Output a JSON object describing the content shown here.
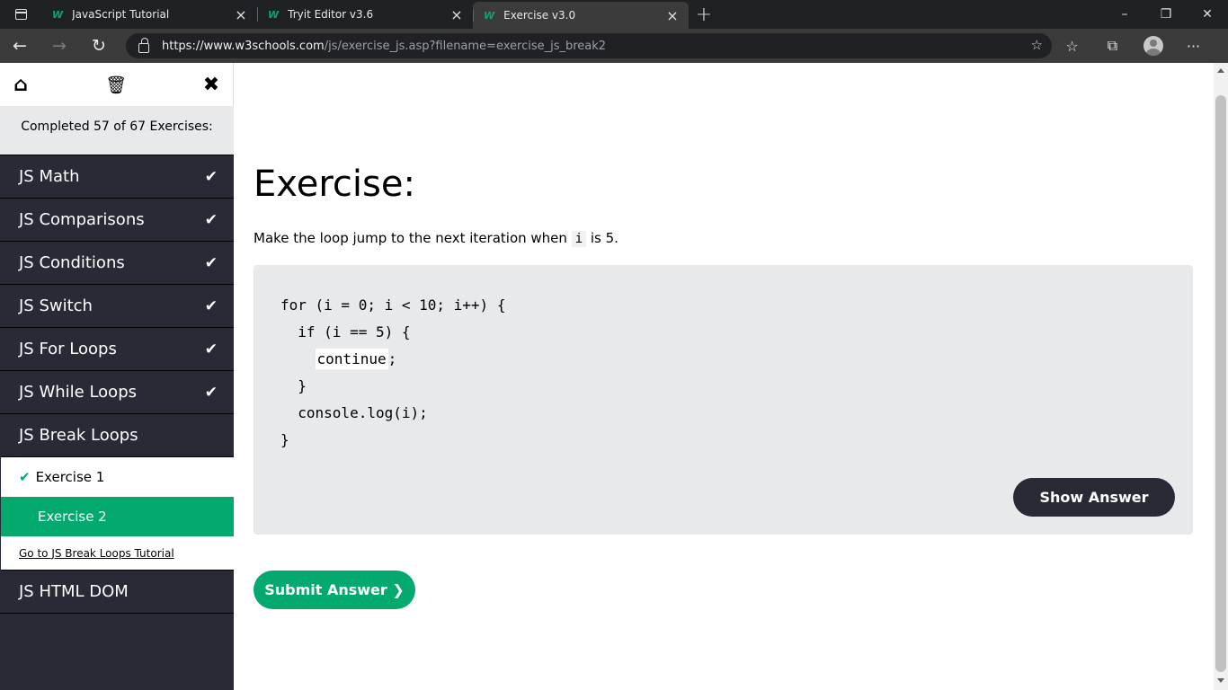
{
  "browser": {
    "tabs": [
      {
        "title": "JavaScript Tutorial",
        "favicon": "w3schools-logo"
      },
      {
        "title": "Tryit Editor v3.6",
        "favicon": "w3schools-logo"
      },
      {
        "title": "Exercise v3.0",
        "favicon": "w3schools-logo",
        "active": true
      }
    ],
    "favicon_text": "W",
    "tab_close": "×",
    "new_tab": "+",
    "url_host": "https://www.w3schools.com",
    "url_path": "/js/exercise_js.asp?filename=exercise_js_break2",
    "win_minimize": "–",
    "win_restore": "❐",
    "win_close": "✕",
    "nav_back": "←",
    "nav_forward": "→",
    "nav_reload": "↻",
    "fav_add": "☆",
    "favorites": "☆",
    "collections": "⧉",
    "more": "···"
  },
  "sidebar": {
    "home_icon": "⌂",
    "trash_icon": "🗑",
    "close_icon": "✖",
    "progress_text": "Completed 57 of 67 Exercises:",
    "check": "✔",
    "items": [
      {
        "label": "JS Math",
        "done": true
      },
      {
        "label": "JS Comparisons",
        "done": true
      },
      {
        "label": "JS Conditions",
        "done": true
      },
      {
        "label": "JS Switch",
        "done": true
      },
      {
        "label": "JS For Loops",
        "done": true
      },
      {
        "label": "JS While Loops",
        "done": true
      },
      {
        "label": "JS Break Loops",
        "done": false
      }
    ],
    "sub_items": [
      {
        "label": "Exercise 1",
        "done": true
      },
      {
        "label": "Exercise 2",
        "active": true
      }
    ],
    "tutorial_link": "Go to JS Break Loops Tutorial",
    "after_items": [
      {
        "label": "JS HTML DOM"
      }
    ]
  },
  "exercise": {
    "title": "Exercise:",
    "desc_before": "Make the loop jump to the next iteration when ",
    "desc_code": "i",
    "desc_after": " is 5.",
    "code_line1": "for (i = 0; i < 10; i++) {",
    "code_line2": "  if (i == 5) {",
    "code_line3_indent": "    ",
    "code_answer": "continue",
    "code_line3_end": ";",
    "code_line4": "  }",
    "code_line5": "  console.log(i);",
    "code_line6": "}",
    "show_answer": "Show Answer",
    "submit_answer": "Submit Answer ❯"
  },
  "colors": {
    "accent_green": "#04aa6d",
    "sidebar_dark": "#282a35",
    "code_bg": "#e7e9eb"
  }
}
